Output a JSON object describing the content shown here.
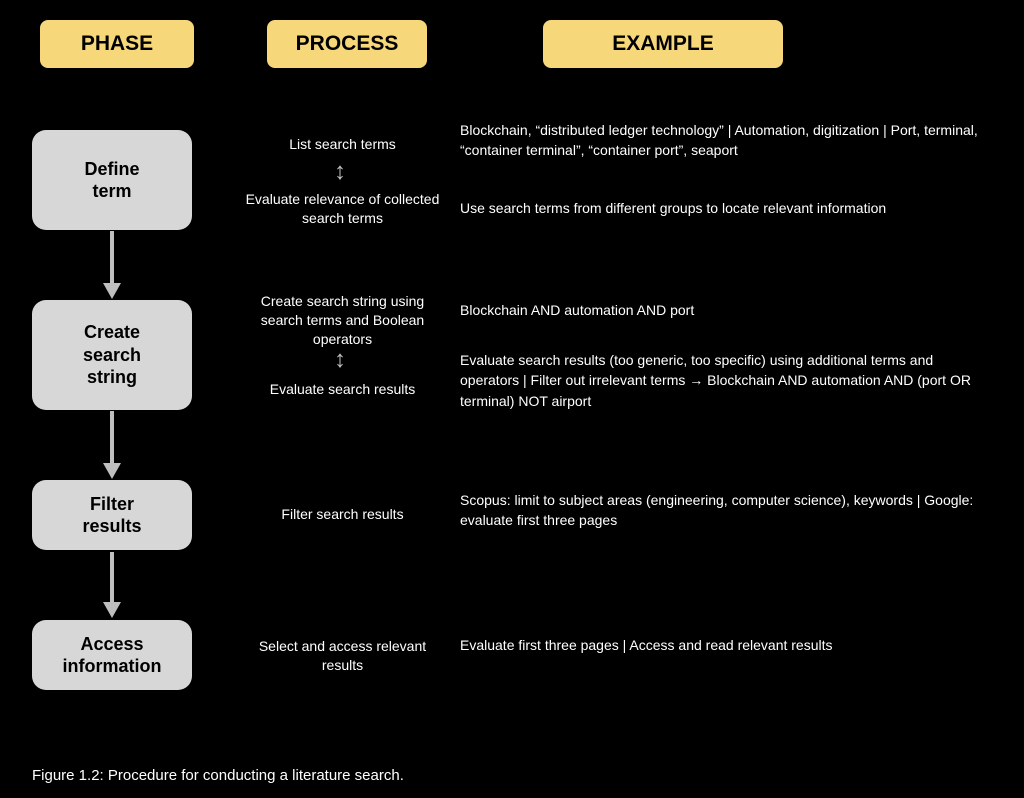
{
  "headers": {
    "phase": "PHASE",
    "process": "PROCESS",
    "example": "EXAMPLE"
  },
  "phases": [
    {
      "label": "Define\nterm"
    },
    {
      "label": "Create\nsearch\nstring"
    },
    {
      "label": "Filter\nresults"
    },
    {
      "label": "Access\ninformation"
    }
  ],
  "process": {
    "p1a": "List search terms",
    "p1b": "Evaluate relevance of collected search terms",
    "p2a": "Create search string using search terms and Boolean operators",
    "p2b": "Evaluate search results",
    "p3": "Filter search results",
    "p4": "Select and access relevant results"
  },
  "example": {
    "e1a": "Blockchain, “distributed ledger technology” | Automation, digitization | Port, terminal, “container terminal”, “container port”, seaport",
    "e1b": "Use search terms from different groups to locate relevant information",
    "e2a": "Blockchain AND automation AND port",
    "e2b": "Evaluate search results (too generic, too specific) using additional terms and operators | Filter out irrelevant terms → Blockchain AND automation AND (port OR terminal) NOT airport",
    "e3": "Scopus: limit to subject areas (engineering, computer science), keywords | Google: evaluate first three pages",
    "e4": "Evaluate first three pages | Access and read relevant results"
  },
  "figure_caption": "Figure 1.2: Procedure for conducting a literature search."
}
